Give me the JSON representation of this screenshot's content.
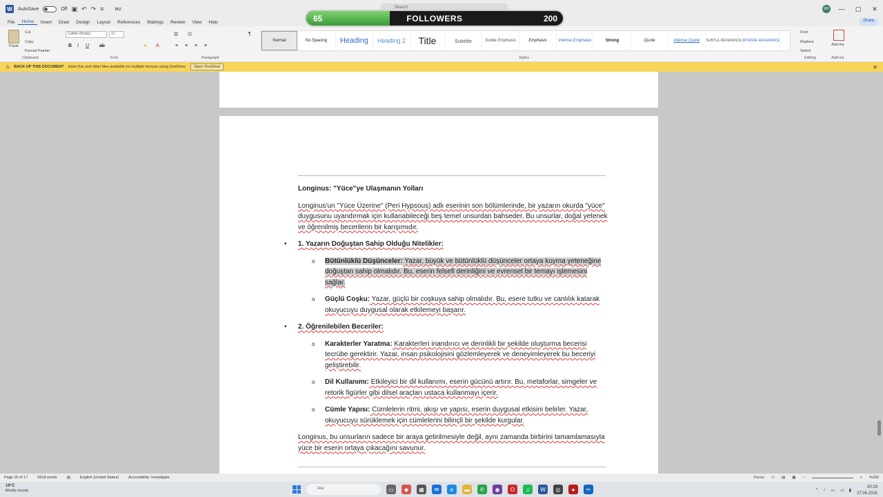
{
  "titlebar": {
    "autosave_label": "AutoSave",
    "autosave_state": "Off",
    "doc_name": "tez",
    "search_placeholder": "Search",
    "user_initials": "MH",
    "controls": [
      "—",
      "▢",
      "✕"
    ]
  },
  "followers_overlay": {
    "current": "65",
    "label": "FOLLOWERS",
    "goal": "200",
    "progress": 0.325
  },
  "menu": {
    "tabs": [
      "File",
      "Home",
      "Insert",
      "Draw",
      "Design",
      "Layout",
      "References",
      "Mailings",
      "Review",
      "View",
      "Help"
    ],
    "active": "Home",
    "share": "Share"
  },
  "ribbon": {
    "clipboard": {
      "paste": "Paste",
      "cut": "Cut",
      "copy": "Copy",
      "format_painter": "Format Painter",
      "label": "Clipboard"
    },
    "font": {
      "family": "Calibri (Body)",
      "size": "11",
      "label": "Font"
    },
    "paragraph": {
      "label": "Paragraph"
    },
    "styles": {
      "label": "Styles",
      "items": [
        "Normal",
        "No Spacing",
        "Heading",
        "Heading 2",
        "Title",
        "Subtitle",
        "Subtle Emphasis",
        "Emphasis",
        "Intense Emphasis",
        "Strong",
        "Quote",
        "Intense Quote",
        "SUBTLE REFERENCE",
        "INTENSE REFERENCE"
      ]
    },
    "editing": {
      "find": "Find",
      "replace": "Replace",
      "select": "Select",
      "label": "Editing"
    },
    "addins": {
      "button": "Add-ins",
      "label": "Add-ins"
    }
  },
  "infobar": {
    "title": "BACK UP THIS DOCUMENT",
    "message": "Have this and other files available on multiple devices using OneDrive.",
    "button": "Open OneDrive"
  },
  "document": {
    "heading": "Longinus: \"Yüce\"ye Ulaşmanın Yolları",
    "intro": "Longinus'un \"Yüce Üzerine\" (Peri Hypsous) adlı eserinin son bölümlerinde, bir yazarın okurda \"yüce\" duygusunu uyandırmak için kullanabileceği beş temel unsurdan bahseder. Bu unsurlar, doğal yetenek ve öğrenilmiş becerilerin bir karışımıdır.",
    "section1_title": "1. Yazarın Doğuştan Sahip Olduğu Nitelikler:",
    "s1_item1_label": "Bütünlüklü Düşünceler:",
    "s1_item1_text": " Yazar, büyük ve bütünlüklü düşünceler ortaya koyma yeteneğine doğuştan sahip olmalıdır. Bu, eserin felsefi derinliğini ve evrensel bir temayı işlemesini sağlar.",
    "s1_item2_label": "Güçlü Coşku:",
    "s1_item2_text": " Yazar, güçlü bir coşkuya sahip olmalıdır. Bu, esere tutku ve canlılık katarak okuyucuyu duygusal olarak etkilemeyi başarır.",
    "section2_title": "2. Öğrenilebilen Beceriler:",
    "s2_item1_label": "Karakterler Yaratma:",
    "s2_item1_text": " Karakterleri inandırıcı ve derinlikli bir şekilde oluşturma becerisi tecrübe gerektirir. Yazar, insan psikolojisini gözlemleyerek ve deneyimleyerek bu beceriyi geliştirebilir.",
    "s2_item2_label": "Dil Kullanımı:",
    "s2_item2_text": " Etkileyici bir dil kullanımı, eserin gücünü artırır. Bu, metaforlar, simgeler ve retorik figürler gibi dilsel araçları ustaca kullanmayı içerir.",
    "s2_item3_label": "Cümle Yapısı:",
    "s2_item3_text": " Cümlelerin ritmi, akışı ve yapısı, eserin duygusal etkisini belirler. Yazar, okuyucuyu sürüklemek için cümlelerini bilinçli bir şekilde kurgular.",
    "conclusion": "Longinus, bu unsurların sadece bir araya getirilmesiyle değil, aynı zamanda birbirini tamamlamasıyla yüce bir eserin ortaya çıkacağını savunur."
  },
  "statusbar": {
    "page": "Page 16 of 17",
    "words": "5618 words",
    "language": "English (United States)",
    "accessibility": "Accessibility: Investigate",
    "focus": "Focus",
    "zoom": "%160"
  },
  "taskbar": {
    "temperature": "19°C",
    "weather": "Mostly cloudy",
    "search": "Ara",
    "time": "00:29",
    "date": "27.06.2025"
  }
}
